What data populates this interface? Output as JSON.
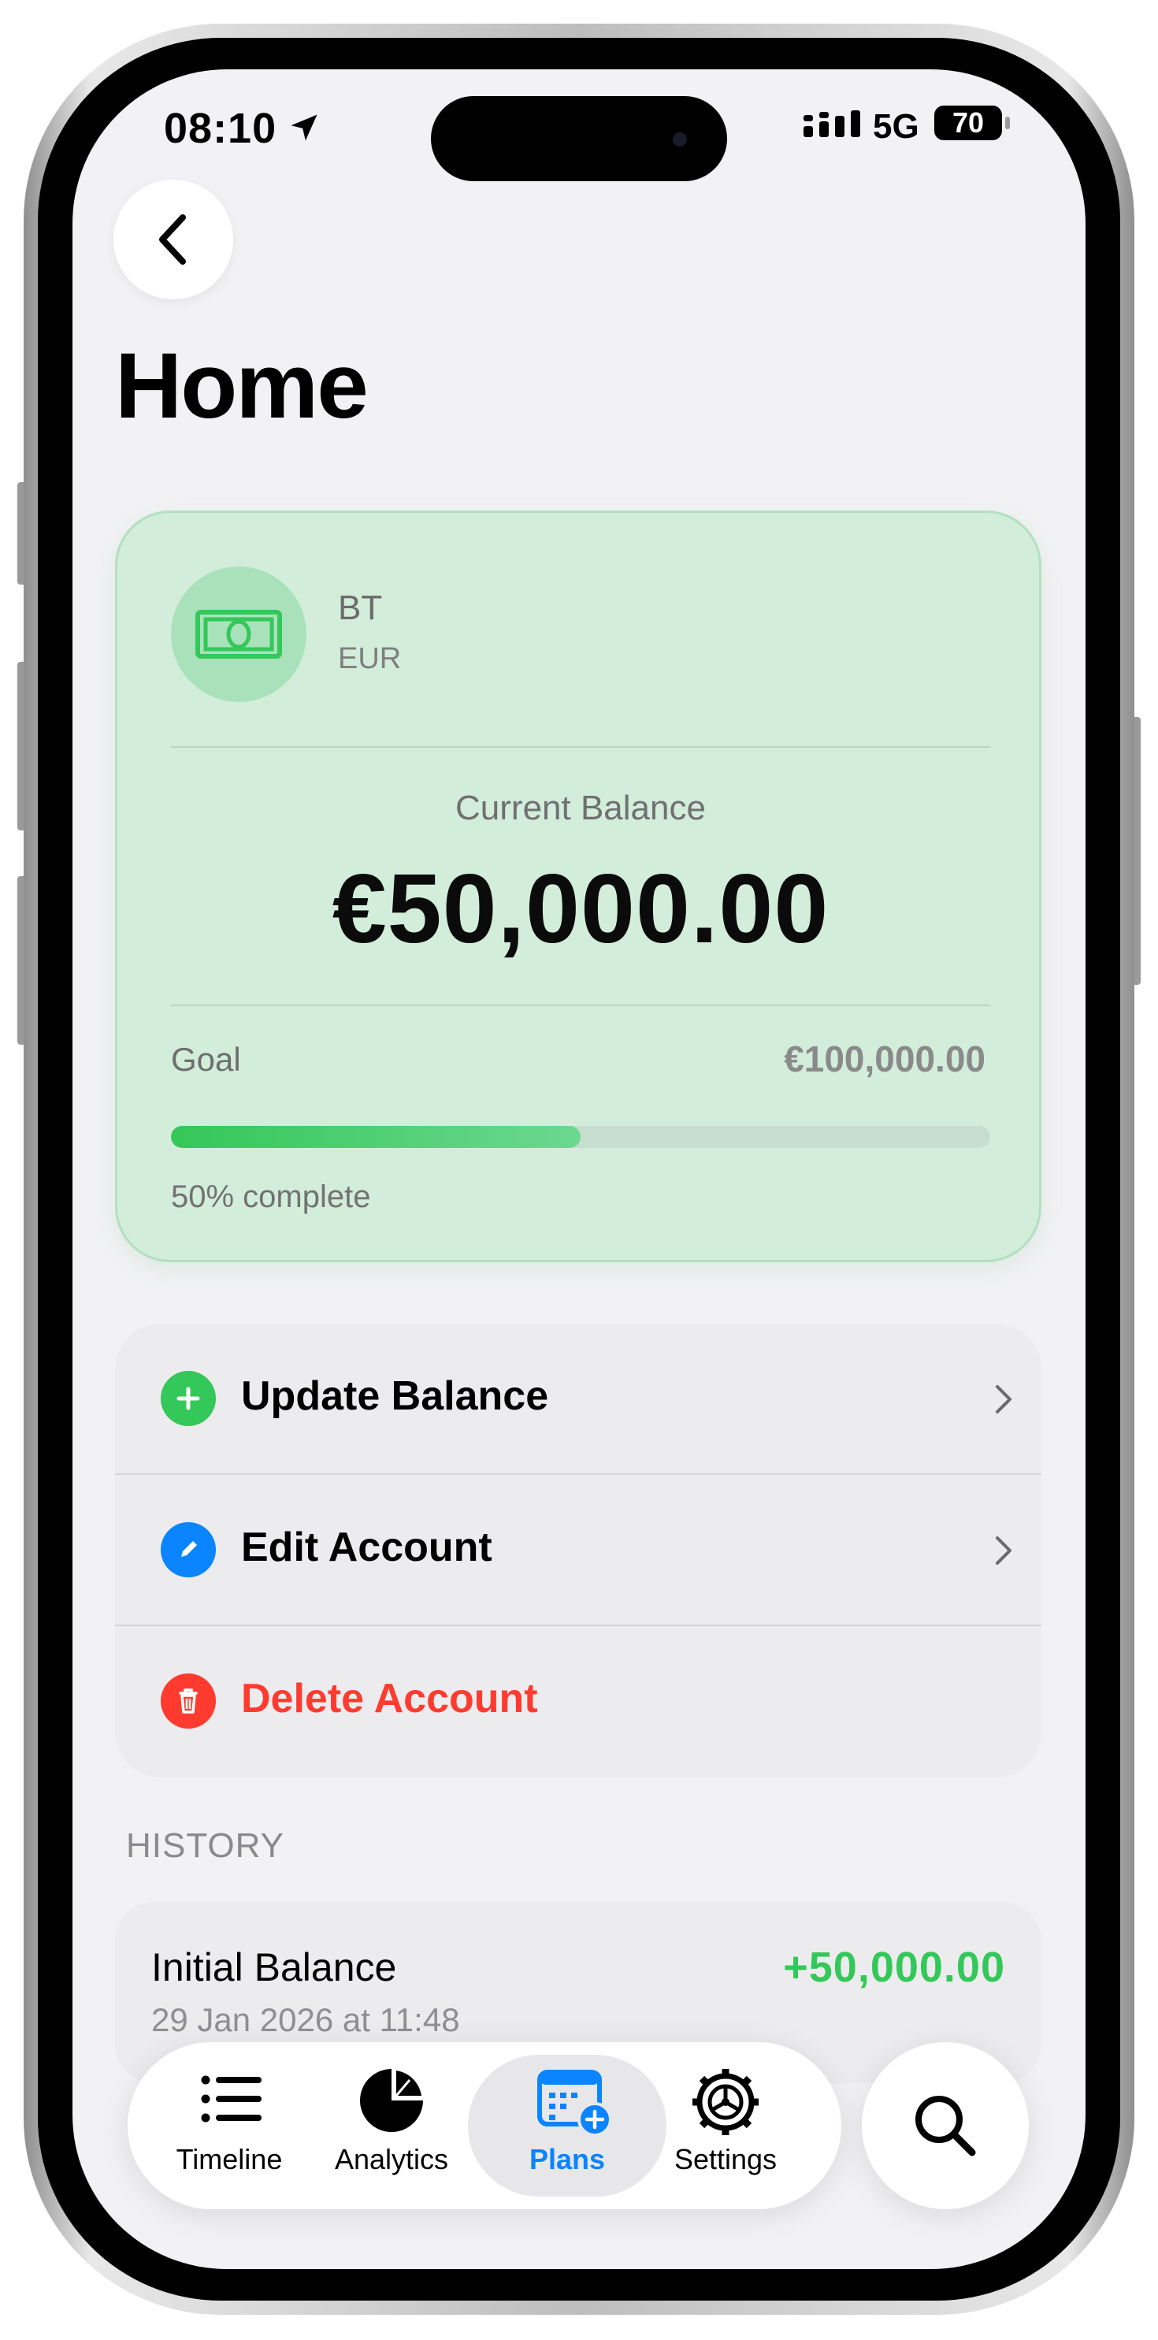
{
  "status_bar": {
    "time": "08:10",
    "network": "5G",
    "battery": "70"
  },
  "page": {
    "title": "Home"
  },
  "account": {
    "name": "BT",
    "currency": "EUR",
    "balance_label": "Current Balance",
    "balance": "€50,000.00",
    "goal_label": "Goal",
    "goal_amount": "€100,000.00",
    "progress_percent": 50,
    "progress_text": "50% complete",
    "accent_color": "#34c759"
  },
  "actions": [
    {
      "label": "Update Balance",
      "icon": "plus-icon",
      "color": "#34c759"
    },
    {
      "label": "Edit Account",
      "icon": "pencil-icon",
      "color": "#0a84ff"
    },
    {
      "label": "Delete Account",
      "icon": "trash-icon",
      "color": "#ff3b30"
    }
  ],
  "history": {
    "section_title": "HISTORY",
    "items": [
      {
        "title": "Initial Balance",
        "date": "29 Jan 2026 at 11:48",
        "amount": "+50,000.00"
      }
    ]
  },
  "tabbar": {
    "tabs": [
      {
        "label": "Timeline",
        "icon": "list-icon",
        "active": false
      },
      {
        "label": "Analytics",
        "icon": "pie-chart-icon",
        "active": false
      },
      {
        "label": "Plans",
        "icon": "calendar-plus-icon",
        "active": true
      },
      {
        "label": "Settings",
        "icon": "gear-icon",
        "active": false
      }
    ],
    "active_color": "#0a84ff",
    "search_icon": "search-icon"
  }
}
